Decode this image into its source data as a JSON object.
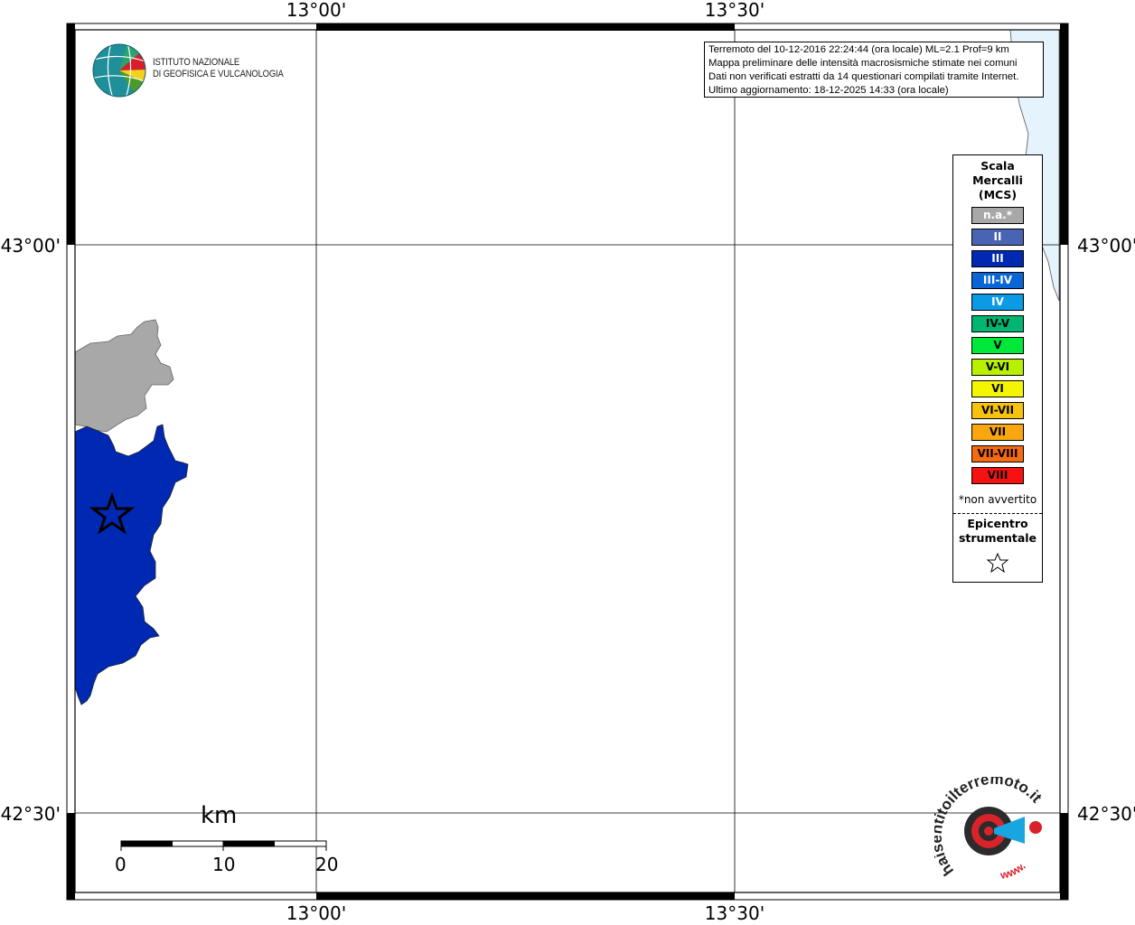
{
  "map": {
    "lon_labels_top": [
      "13°00'",
      "13°30'"
    ],
    "lon_labels_bottom": [
      "13°00'",
      "13°30'"
    ],
    "lat_labels_left": [
      "43°00'",
      "42°30'"
    ],
    "lat_labels_right": [
      "43°00'",
      "42°30'"
    ],
    "colors": {
      "sea": "#e4f3fc",
      "not_felt": "#a8a8a8",
      "intensity_III": "#0029b3"
    }
  },
  "info": {
    "line1": "Terremoto del 10-12-2016 22:24:44 (ora locale) ML=2.1 Prof=9 km",
    "line2": "Mappa preliminare delle intensità macrosismiche stimate nei comuni",
    "line3": "Dati non verificati estratti da 14 questionari compilati tramite Internet.",
    "line4": "Ultimo aggiornamento: 18-12-2025 14:33 (ora locale)"
  },
  "logo": {
    "line1": "ISTITUTO NAZIONALE",
    "line2": "DI GEOFISICA E VULCANOLOGIA"
  },
  "legend": {
    "title": "Scala Mercalli (MCS)",
    "items": [
      {
        "label": "n.a.*",
        "color": "#a8a8a8",
        "text_color": "#ffffff"
      },
      {
        "label": "II",
        "color": "#4a64b4",
        "text_color": "#ffffff"
      },
      {
        "label": "III",
        "color": "#0029b3",
        "text_color": "#ffffff"
      },
      {
        "label": "III-IV",
        "color": "#0a66d6",
        "text_color": "#ffffff"
      },
      {
        "label": "IV",
        "color": "#0a9ae6",
        "text_color": "#ffffff"
      },
      {
        "label": "IV-V",
        "color": "#00b670",
        "text_color": "#000000"
      },
      {
        "label": "V",
        "color": "#00e83a",
        "text_color": "#000000"
      },
      {
        "label": "V-VI",
        "color": "#b8f000",
        "text_color": "#000000"
      },
      {
        "label": "VI",
        "color": "#f5f500",
        "text_color": "#000000"
      },
      {
        "label": "VI-VII",
        "color": "#f7c20d",
        "text_color": "#000000"
      },
      {
        "label": "VII",
        "color": "#f9a60f",
        "text_color": "#000000"
      },
      {
        "label": "VII-VIII",
        "color": "#f76a10",
        "text_color": "#000000"
      },
      {
        "label": "VIII",
        "color": "#f71212",
        "text_color": "#000000"
      }
    ],
    "note": "*non avvertito",
    "epicenter_label": "Epicentro strumentale"
  },
  "scalebar": {
    "unit": "km",
    "ticks": [
      "0",
      "10",
      "20"
    ]
  },
  "hs_logo": {
    "ring_text": "haisentitoilterremoto.it",
    "url_text": "www."
  }
}
